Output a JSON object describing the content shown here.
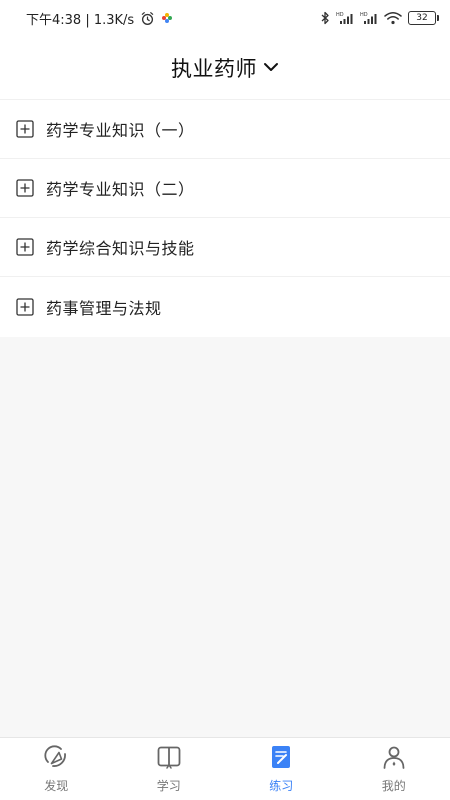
{
  "status_bar": {
    "time_speed": "下午4:38 | 1.3K/s",
    "battery": "32",
    "hd_label": "HD"
  },
  "header": {
    "title": "执业药师"
  },
  "list": {
    "items": [
      {
        "label": "药学专业知识（一）"
      },
      {
        "label": "药学专业知识（二）"
      },
      {
        "label": "药学综合知识与技能"
      },
      {
        "label": "药事管理与法规"
      }
    ]
  },
  "bottom_nav": {
    "active_color": "#3b82f6",
    "items": [
      {
        "label": "发现",
        "icon": "discover-icon"
      },
      {
        "label": "学习",
        "icon": "book-icon"
      },
      {
        "label": "练习",
        "icon": "practice-icon",
        "active": true
      },
      {
        "label": "我的",
        "icon": "profile-icon"
      }
    ]
  }
}
